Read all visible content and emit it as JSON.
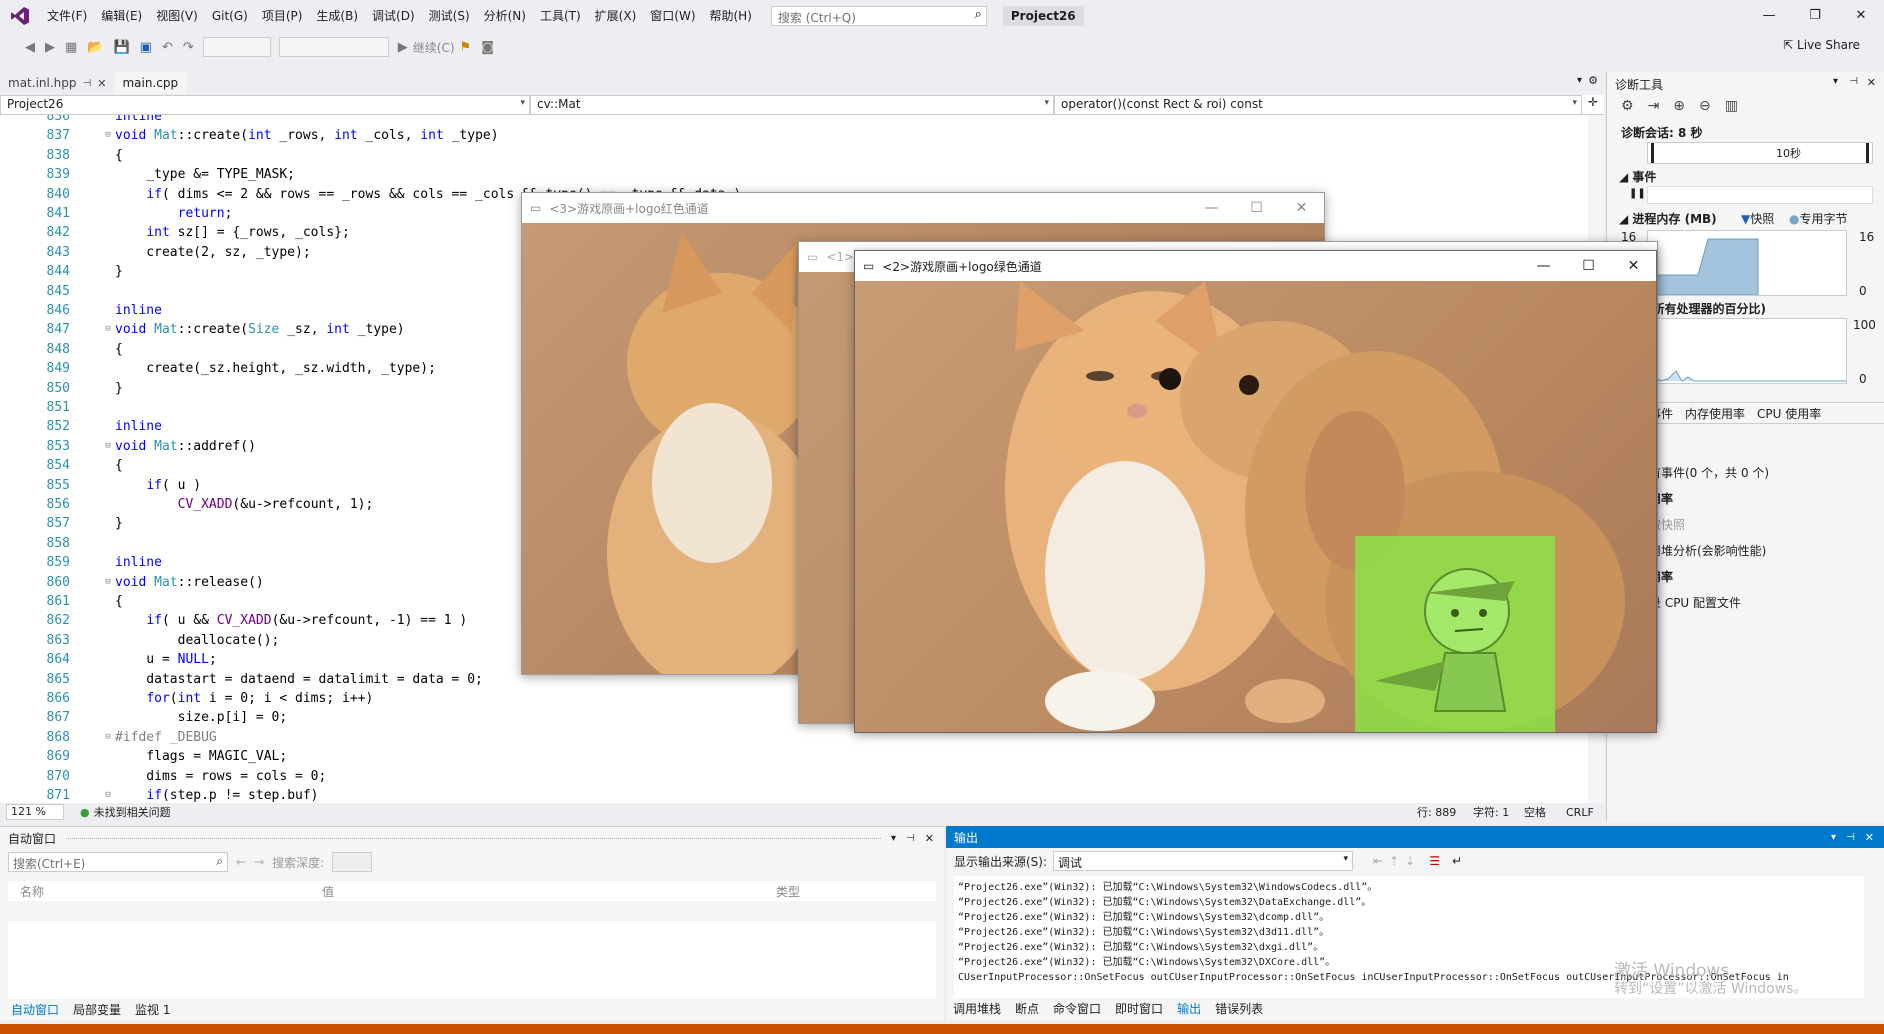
{
  "titlebar": {
    "menus": [
      "文件(F)",
      "编辑(E)",
      "视图(V)",
      "Git(G)",
      "项目(P)",
      "生成(B)",
      "调试(D)",
      "测试(S)",
      "分析(N)",
      "工具(T)",
      "扩展(X)",
      "窗口(W)",
      "帮助(H)"
    ],
    "search_placeholder": "搜索 (Ctrl+Q)",
    "project_name": "Project26"
  },
  "toolbar": {
    "continue_label": "继续(C)",
    "live_share": "Live Share"
  },
  "editor": {
    "tabs": [
      {
        "label": "mat.inl.hpp",
        "active": false
      },
      {
        "label": "main.cpp",
        "active": true
      }
    ],
    "nav": {
      "project": "Project26",
      "scope": "cv::Mat",
      "member": "operator()(const Rect & roi) const"
    },
    "lines": [
      {
        "n": "836",
        "t": "inline"
      },
      {
        "n": "837",
        "t": "void Mat::create(int _rows, int _cols, int _type)",
        "fold": "⊟"
      },
      {
        "n": "838",
        "t": "{"
      },
      {
        "n": "839",
        "t": "    _type &= TYPE_MASK;"
      },
      {
        "n": "840",
        "t": "    if( dims <= 2 && rows == _rows && cols == _cols && type() == _type && data )"
      },
      {
        "n": "841",
        "t": "        return;"
      },
      {
        "n": "842",
        "t": "    int sz[] = {_rows, _cols};"
      },
      {
        "n": "843",
        "t": "    create(2, sz, _type);"
      },
      {
        "n": "844",
        "t": "}"
      },
      {
        "n": "845",
        "t": ""
      },
      {
        "n": "846",
        "t": "inline"
      },
      {
        "n": "847",
        "t": "void Mat::create(Size _sz, int _type)",
        "fold": "⊟"
      },
      {
        "n": "848",
        "t": "{"
      },
      {
        "n": "849",
        "t": "    create(_sz.height, _sz.width, _type);"
      },
      {
        "n": "850",
        "t": "}"
      },
      {
        "n": "851",
        "t": ""
      },
      {
        "n": "852",
        "t": "inline"
      },
      {
        "n": "853",
        "t": "void Mat::addref()",
        "fold": "⊟"
      },
      {
        "n": "854",
        "t": "{"
      },
      {
        "n": "855",
        "t": "    if( u )"
      },
      {
        "n": "856",
        "t": "        CV_XADD(&u->refcount, 1);"
      },
      {
        "n": "857",
        "t": "}"
      },
      {
        "n": "858",
        "t": ""
      },
      {
        "n": "859",
        "t": "inline"
      },
      {
        "n": "860",
        "t": "void Mat::release()",
        "fold": "⊟"
      },
      {
        "n": "861",
        "t": "{"
      },
      {
        "n": "862",
        "t": "    if( u && CV_XADD(&u->refcount, -1) == 1 )"
      },
      {
        "n": "863",
        "t": "        deallocate();"
      },
      {
        "n": "864",
        "t": "    u = NULL;"
      },
      {
        "n": "865",
        "t": "    datastart = dataend = datalimit = data = 0;"
      },
      {
        "n": "866",
        "t": "    for(int i = 0; i < dims; i++)"
      },
      {
        "n": "867",
        "t": "        size.p[i] = 0;"
      },
      {
        "n": "868",
        "t": "#ifdef _DEBUG",
        "fold": "⊟"
      },
      {
        "n": "869",
        "t": "    flags = MAGIC_VAL;"
      },
      {
        "n": "870",
        "t": "    dims = rows = cols = 0;"
      },
      {
        "n": "871",
        "t": "    if(step.p != step.buf)",
        "fold": "⊟"
      }
    ],
    "status": {
      "zoom": "121 %",
      "issues": "未找到相关问题",
      "line": "行: 889",
      "char": "字符: 1",
      "indent": "空格",
      "eol": "CRLF"
    }
  },
  "windows": {
    "red": {
      "title": "<3>游戏原画+logo红色通道"
    },
    "mid": {
      "title": "<1>"
    },
    "green": {
      "title": "<2>游戏原画+logo绿色通道"
    }
  },
  "diag": {
    "title": "诊断工具",
    "session": "诊断会话: 8 秒",
    "timeline_label": "10秒",
    "events": "事件",
    "process_memory": "进程内存 (MB)",
    "snapshot": "快照",
    "private_bytes": "专用字节",
    "mem_max": "16",
    "mem_min": "0",
    "mem_max_r": "16",
    "mem_min_r": "0",
    "cpu_title": "(所有处理器的百分比)",
    "cpu_max": "100",
    "cpu_min": "0",
    "tabs": [
      "事件",
      "内存使用率",
      "CPU 使用率"
    ],
    "rows": [
      "有事件(0 个，共 0 个)",
      "用率",
      "取快照",
      "用堆分析(会影响性能)",
      "用率",
      "录 CPU 配置文件"
    ]
  },
  "auto_panel": {
    "title": "自动窗口",
    "search_placeholder": "搜索(Ctrl+E)",
    "depth_label": "搜索深度:",
    "columns": [
      "名称",
      "值",
      "类型"
    ],
    "bottom_tabs": [
      "自动窗口",
      "局部变量",
      "监视 1"
    ]
  },
  "output_panel": {
    "title": "输出",
    "source_label": "显示输出来源(S):",
    "source_value": "调试",
    "lines": [
      "“Project26.exe”(Win32): 已加载“C:\\Windows\\System32\\WindowsCodecs.dll”。",
      "“Project26.exe”(Win32): 已加载“C:\\Windows\\System32\\DataExchange.dll”。",
      "“Project26.exe”(Win32): 已加载“C:\\Windows\\System32\\dcomp.dll”。",
      "“Project26.exe”(Win32): 已加载“C:\\Windows\\System32\\d3d11.dll”。",
      "“Project26.exe”(Win32): 已加载“C:\\Windows\\System32\\dxgi.dll”。",
      "“Project26.exe”(Win32): 已加载“C:\\Windows\\System32\\DXCore.dll”。",
      "CUserInputProcessor::OnSetFocus outCUserInputProcessor::OnSetFocus inCUserInputProcessor::OnSetFocus outCUserInputProcessor::OnSetFocus in"
    ],
    "watermark1": "激活 Windows",
    "watermark2": "转到“设置”以激活 Windows。",
    "bottom_tabs": [
      "调用堆栈",
      "断点",
      "命令窗口",
      "即时窗口",
      "输出",
      "错误列表"
    ]
  },
  "colors": {
    "accent": "#007acc",
    "statusbar": "#ca5100",
    "line_number": "#2b91af",
    "keyword": "#0000ff",
    "type": "#2b91af"
  }
}
